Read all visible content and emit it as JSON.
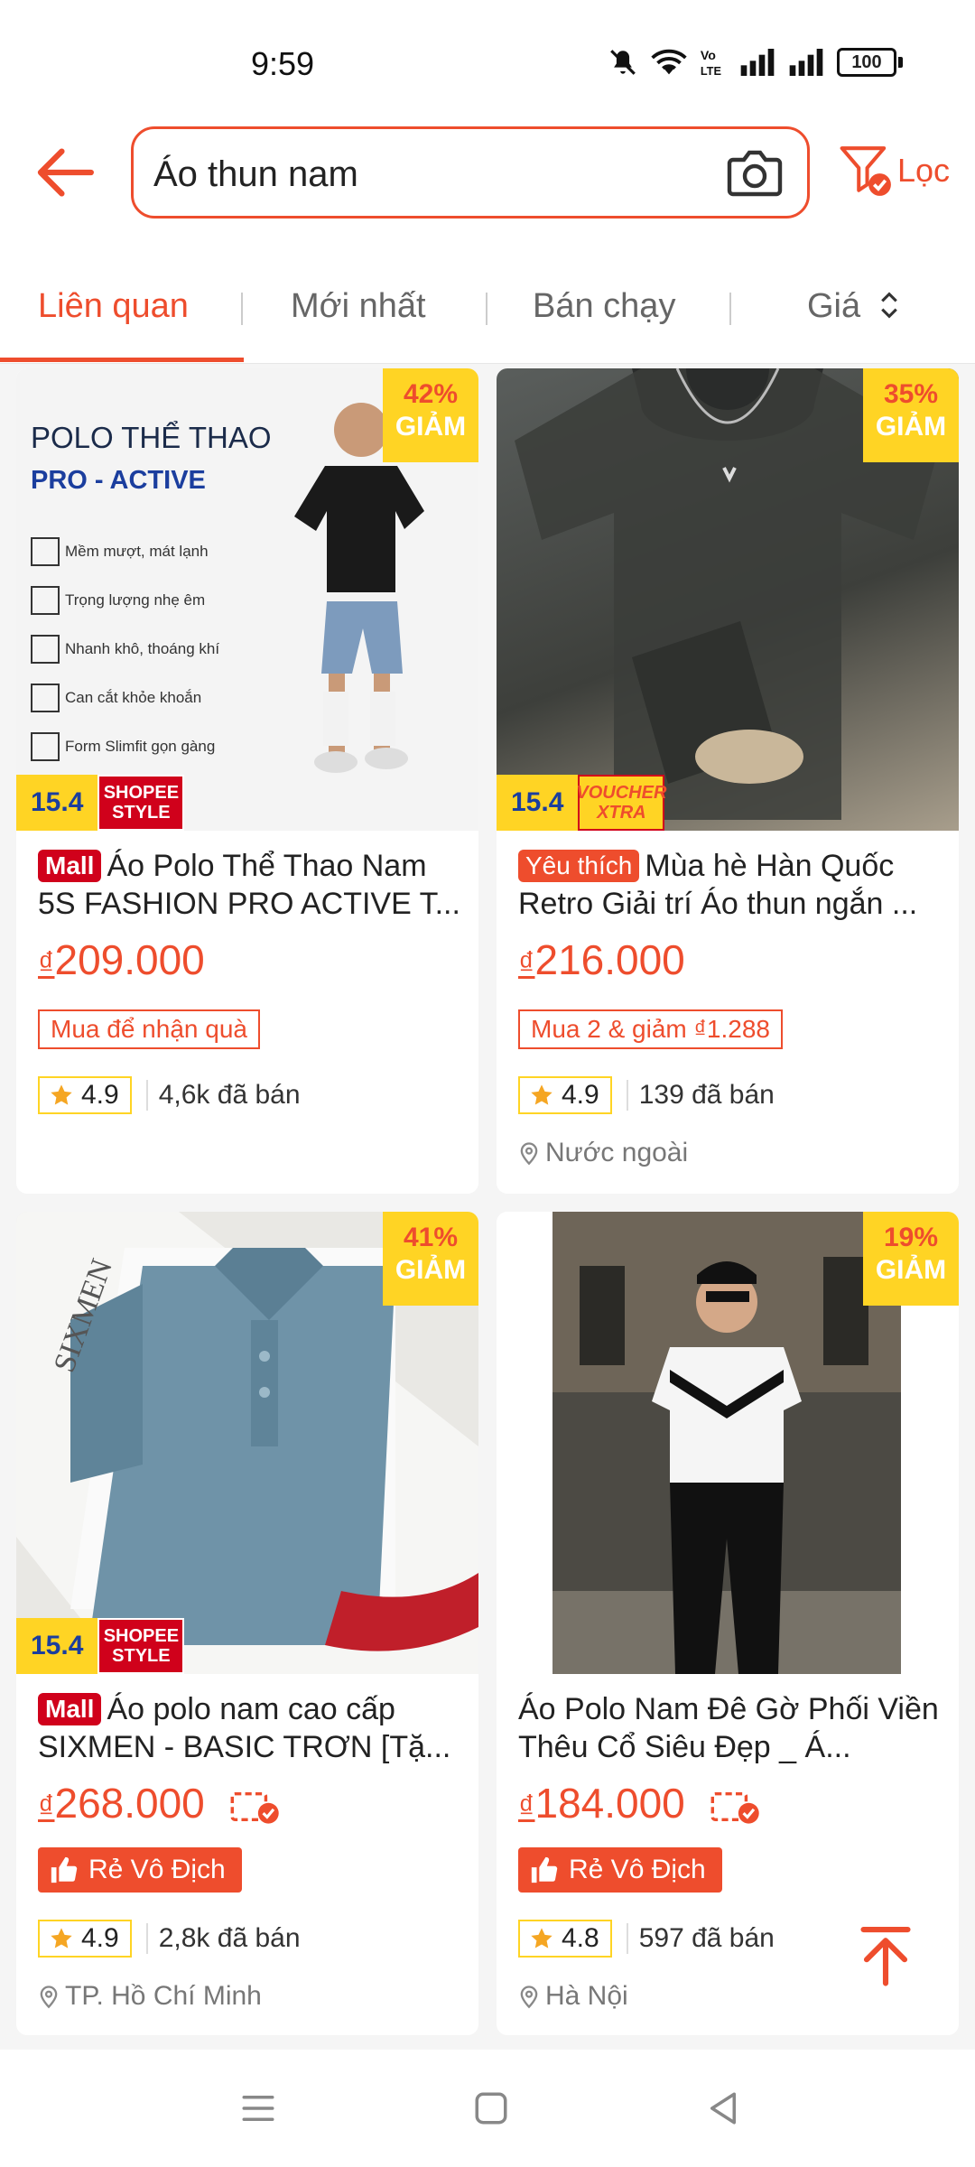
{
  "status_bar": {
    "time": "9:59",
    "battery": "100"
  },
  "header": {
    "search_value": "Áo thun nam",
    "filter_label": "Lọc"
  },
  "tabs": [
    {
      "label": "Liên quan",
      "active": true
    },
    {
      "label": "Mới nhất",
      "active": false
    },
    {
      "label": "Bán chạy",
      "active": false
    },
    {
      "label": "Giá",
      "active": false
    }
  ],
  "products": [
    {
      "discount_pct": "42%",
      "discount_word": "GIẢM",
      "date_badge": "15.4",
      "campaign_badge": [
        "SHOPEE",
        "STYLE"
      ],
      "image_text": {
        "heading1": "POLO THỂ THAO",
        "heading2": "PRO - ACTIVE",
        "features": [
          "Mềm mượt, mát lạnh",
          "Trọng lượng nhẹ êm",
          "Nhanh khô, thoáng khí",
          "Can cắt khỏe khoắn",
          "Form Slimfit gọn gàng"
        ]
      },
      "label": "Mall",
      "title": "Áo Polo Thể Thao Nam 5S FASHION PRO ACTIVE T...",
      "currency": "₫",
      "price": "209.000",
      "promo": "Mua để nhận quà",
      "rating": "4.9",
      "sold": "4,6k đã bán"
    },
    {
      "discount_pct": "35%",
      "discount_word": "GIẢM",
      "date_badge": "15.4",
      "campaign_badge": [
        "VOUCHER",
        "XTRA"
      ],
      "label": "Yêu thích",
      "title": "Mùa hè Hàn Quốc Retro Giải trí Áo thun ngắn ...",
      "currency": "₫",
      "price": "216.000",
      "promo": "Mua 2 & giảm ₫1.288",
      "rating": "4.9",
      "sold": "139 đã bán",
      "location": "Nước ngoài"
    },
    {
      "discount_pct": "41%",
      "discount_word": "GIẢM",
      "date_badge": "15.4",
      "campaign_badge": [
        "SHOPEE",
        "STYLE"
      ],
      "image_text": {
        "brand": "SIXMEN"
      },
      "label": "Mall",
      "title": "Áo polo nam cao cấp SIXMEN - BASIC TRƠN [Tặ...",
      "currency": "₫",
      "price": "268.000",
      "badge": "Rẻ Vô Địch",
      "rating": "4.9",
      "sold": "2,8k đã bán",
      "location": "TP. Hồ Chí Minh"
    },
    {
      "discount_pct": "19%",
      "discount_word": "GIẢM",
      "title": "Áo Polo Nam Đê Gờ Phối Viền Thêu Cổ Siêu Đẹp _ Á...",
      "currency": "₫",
      "price": "184.000",
      "badge": "Rẻ Vô Địch",
      "rating": "4.8",
      "sold": "597 đã bán",
      "location": "Hà Nội"
    }
  ],
  "colors": {
    "accent": "#ee4d2d",
    "mall": "#d0011b",
    "discount_bg": "#ffd424",
    "rating_border": "#ffd424"
  },
  "icons": [
    "back-arrow-icon",
    "camera-icon",
    "filter-icon",
    "sort-icon",
    "star-icon",
    "location-pin-icon",
    "free-ship-icon",
    "thumbs-up-icon",
    "scroll-top-icon",
    "nav-menu-icon",
    "nav-home-icon",
    "nav-back-icon"
  ]
}
